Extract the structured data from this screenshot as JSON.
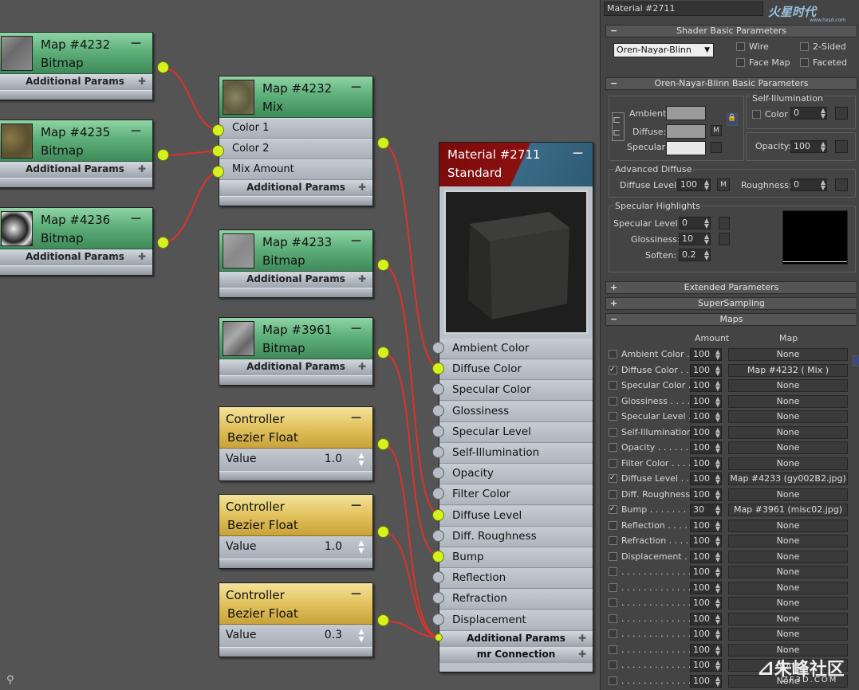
{
  "canvas": {
    "nodes": [
      {
        "id": "bmp4232",
        "title": "Map #4232",
        "subtitle": "Bitmap",
        "footer": "Additional Params"
      },
      {
        "id": "bmp4235",
        "title": "Map #4235",
        "subtitle": "Bitmap",
        "footer": "Additional Params"
      },
      {
        "id": "bmp4236",
        "title": "Map #4236",
        "subtitle": "Bitmap",
        "footer": "Additional Params"
      },
      {
        "id": "mix4232",
        "title": "Map #4232",
        "subtitle": "Mix",
        "slots": [
          "Color 1",
          "Color 2",
          "Mix Amount"
        ],
        "footer": "Additional Params"
      },
      {
        "id": "bmp4233",
        "title": "Map #4233",
        "subtitle": "Bitmap",
        "footer": "Additional Params"
      },
      {
        "id": "bmp3961",
        "title": "Map #3961",
        "subtitle": "Bitmap",
        "footer": "Additional Params"
      },
      {
        "id": "ctrl1",
        "title": "Controller",
        "subtitle": "Bezier Float",
        "label": "Value",
        "value": "1.0"
      },
      {
        "id": "ctrl2",
        "title": "Controller",
        "subtitle": "Bezier Float",
        "label": "Value",
        "value": "1.0"
      },
      {
        "id": "ctrl3",
        "title": "Controller",
        "subtitle": "Bezier Float",
        "label": "Value",
        "value": "0.3"
      }
    ],
    "material": {
      "title": "Material #2711",
      "subtitle": "Standard",
      "slots": [
        "Ambient Color",
        "Diffuse Color",
        "Specular Color",
        "Glossiness",
        "Specular Level",
        "Self-Illumination",
        "Opacity",
        "Filter Color",
        "Diffuse Level",
        "Diff. Roughness",
        "Bump",
        "Reflection",
        "Refraction",
        "Displacement"
      ],
      "connected": [
        false,
        true,
        false,
        false,
        false,
        false,
        false,
        false,
        true,
        false,
        true,
        false,
        false,
        false
      ],
      "footer1": "Additional Params",
      "footer2": "mr Connection"
    },
    "binoculars_icon": "binoculars-icon"
  },
  "panel": {
    "material_name": "Material #2711",
    "logo_text": "火星时代",
    "logo_sub": "www.hxsd.com",
    "shader_rollout": "Shader Basic Parameters",
    "shader_type": "Oren-Nayar-Blinn",
    "wire": "Wire",
    "two_sided": "2-Sided",
    "face_map": "Face Map",
    "faceted": "Faceted",
    "basic_rollout": "Oren-Nayar-Blinn Basic Parameters",
    "ambient": "Ambient:",
    "diffuse": "Diffuse:",
    "specular": "Specular:",
    "m": "M",
    "self_illum_group": "Self-Illumination",
    "color_label": "Color",
    "color_value": "0",
    "opacity_label": "Opacity:",
    "opacity_value": "100",
    "adv_diffuse_group": "Advanced Diffuse",
    "diffuse_level_label": "Diffuse Level:",
    "diffuse_level_value": "100",
    "roughness_label": "Roughness:",
    "roughness_value": "0",
    "spec_group": "Specular Highlights",
    "spec_level_label": "Specular Level:",
    "spec_level_value": "0",
    "gloss_label": "Glossiness:",
    "gloss_value": "10",
    "soften_label": "Soften:",
    "soften_value": "0.2",
    "extended_rollout": "Extended Parameters",
    "supersampling_rollout": "SuperSampling",
    "maps_rollout": "Maps",
    "maps_col_amount": "Amount",
    "maps_col_map": "Map",
    "maps": [
      {
        "label": "Ambient Color . .",
        "checked": false,
        "amount": "100",
        "map": "None"
      },
      {
        "label": "Diffuse Color . . .",
        "checked": true,
        "amount": "100",
        "map": "Map #4232  ( Mix )"
      },
      {
        "label": "Specular Color . .",
        "checked": false,
        "amount": "100",
        "map": "None"
      },
      {
        "label": "Glossiness . . . . .",
        "checked": false,
        "amount": "100",
        "map": "None"
      },
      {
        "label": "Specular Level . .",
        "checked": false,
        "amount": "100",
        "map": "None"
      },
      {
        "label": "Self-Illumination .",
        "checked": false,
        "amount": "100",
        "map": "None"
      },
      {
        "label": "Opacity . . . . . . .",
        "checked": false,
        "amount": "100",
        "map": "None"
      },
      {
        "label": "Filter Color . . . .",
        "checked": false,
        "amount": "100",
        "map": "None"
      },
      {
        "label": "Diffuse Level . . .",
        "checked": true,
        "amount": "100",
        "map": "Map #4233 (gy002B2.jpg)"
      },
      {
        "label": "Diff. Roughness .",
        "checked": false,
        "amount": "100",
        "map": "None"
      },
      {
        "label": "Bump . . . . . . . .",
        "checked": true,
        "amount": "30",
        "map": "Map #3961 (misc02.jpg)"
      },
      {
        "label": "Reflection . . . . .",
        "checked": false,
        "amount": "100",
        "map": "None"
      },
      {
        "label": "Refraction . . . . .",
        "checked": false,
        "amount": "100",
        "map": "None"
      },
      {
        "label": "Displacement . . .",
        "checked": false,
        "amount": "100",
        "map": "None"
      },
      {
        "label": ". . . . . . . . . . . . .",
        "checked": false,
        "amount": "100",
        "map": "None"
      },
      {
        "label": ". . . . . . . . . . . . .",
        "checked": false,
        "amount": "100",
        "map": "None"
      },
      {
        "label": ". . . . . . . . . . . . .",
        "checked": false,
        "amount": "100",
        "map": "None"
      },
      {
        "label": ". . . . . . . . . . . . .",
        "checked": false,
        "amount": "100",
        "map": "None"
      },
      {
        "label": ". . . . . . . . . . . . .",
        "checked": false,
        "amount": "100",
        "map": "None"
      },
      {
        "label": ". . . . . . . . . . . . .",
        "checked": false,
        "amount": "100",
        "map": "None"
      },
      {
        "label": ". . . . . . . . . . . . .",
        "checked": false,
        "amount": "100",
        "map": "None"
      },
      {
        "label": ". . . . . . . . . . . . .",
        "checked": false,
        "amount": "100",
        "map": "None"
      }
    ],
    "watermark": "朱峰社区",
    "watermark_sub": "ZF3D.COM"
  },
  "colors": {
    "wire": "#e0312a",
    "socket": "#d6f21e",
    "green_node": "#5fb07a",
    "yellow_node": "#e2c25e",
    "material_red": "#8b1010",
    "material_blue": "#2d5a74"
  }
}
